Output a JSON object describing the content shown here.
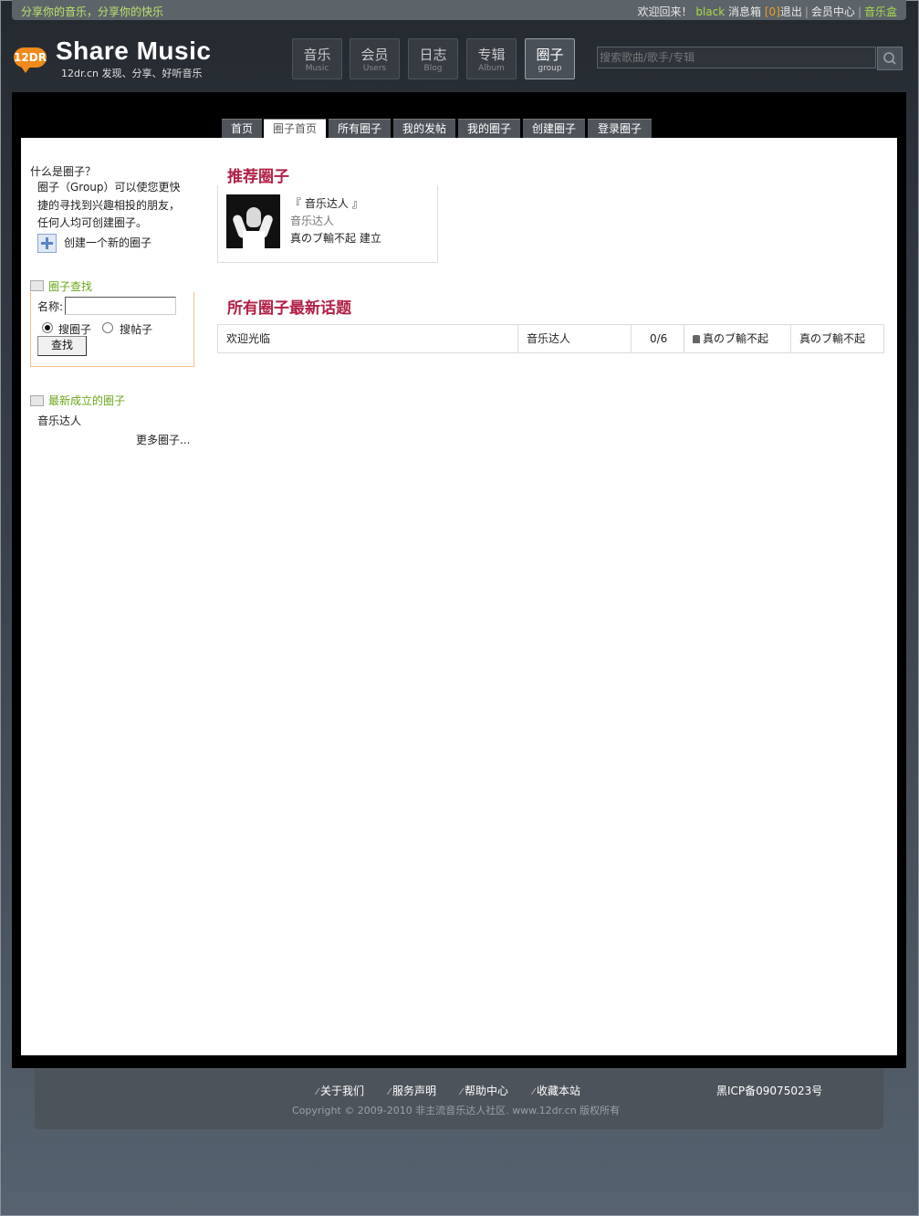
{
  "topbar": {
    "slogan": "分享你的音乐，分享你的快乐",
    "welcome": "欢迎回来！",
    "username": "black",
    "inbox_label": "消息箱",
    "inbox_count": "[0]",
    "logout": "退出",
    "member_center": "会员中心",
    "music_box": "音乐盒"
  },
  "logo": {
    "badge": "12DR",
    "title": "Share Music",
    "subtitle": "12dr.cn 发现、分享、好听音乐"
  },
  "nav": [
    {
      "cn": "音乐",
      "en": "Music"
    },
    {
      "cn": "会员",
      "en": "Users"
    },
    {
      "cn": "日志",
      "en": "Blog"
    },
    {
      "cn": "专辑",
      "en": "Album"
    },
    {
      "cn": "圈子",
      "en": "group"
    }
  ],
  "search": {
    "placeholder": "搜索歌曲/歌手/专辑"
  },
  "tabs": [
    "首页",
    "圈子首页",
    "所有圈子",
    "我的发帖",
    "我的圈子",
    "创建圈子",
    "登录圈子"
  ],
  "sidebar": {
    "what_title": "什么是圈子？",
    "what_desc": "圈子（Group）可以使您更快捷的寻找到兴趣相投的朋友，任何人均可创建圈子。",
    "create_link": "创建一个新的圈子",
    "find_title": "圈子查找",
    "name_label": "名称:",
    "radio_group": "搜圈子",
    "radio_post": "搜帖子",
    "find_button": "查找",
    "newest_title": "最新成立的圈子",
    "newest_items": [
      "音乐达人"
    ],
    "more": "更多圈子..."
  },
  "recommended": {
    "title": "推荐圈子",
    "name": "『 音乐达人 』",
    "category": "音乐达人",
    "creator": "真のブ輸不起 建立"
  },
  "topics": {
    "title": "所有圈子最新话题",
    "rows": [
      {
        "subject": "欢迎光临",
        "group": "音乐达人",
        "counts": "0/6",
        "author": "真のブ輸不起",
        "last_reply": "真のブ輸不起"
      }
    ]
  },
  "footer": {
    "links": [
      "关于我们",
      "服务声明",
      "帮助中心",
      "收藏本站"
    ],
    "icp": "黑ICP备09075023号",
    "copyright": "Copyright © 2009-2010 非主流音乐达人社区. www.12dr.cn 版权所有"
  }
}
